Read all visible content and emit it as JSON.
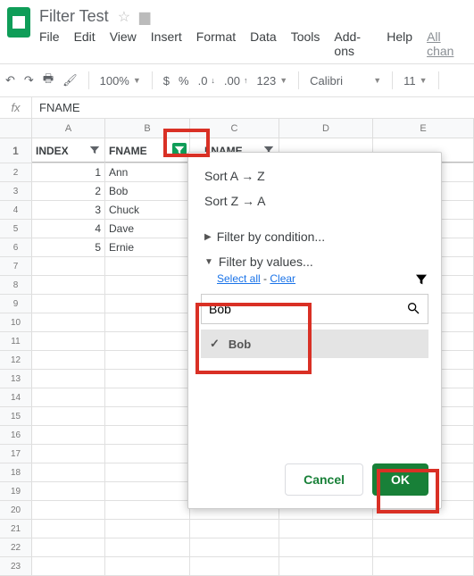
{
  "doc": {
    "title": "Filter Test"
  },
  "menu": {
    "file": "File",
    "edit": "Edit",
    "view": "View",
    "insert": "Insert",
    "format": "Format",
    "data": "Data",
    "tools": "Tools",
    "addons": "Add-ons",
    "help": "Help",
    "allchanges": "All chan"
  },
  "toolbar": {
    "zoom": "100%",
    "dollar": "$",
    "percent": "%",
    "dec_less": ".0",
    "dec_more": ".00",
    "numfmt": "123",
    "font": "Calibri",
    "size": "11"
  },
  "formula": {
    "value": "FNAME"
  },
  "columns": {
    "a": "A",
    "b": "B",
    "c": "C",
    "d": "D",
    "e": "E"
  },
  "headers": {
    "a": "INDEX",
    "b": "FNAME",
    "c": "LNAME"
  },
  "data_rows": {
    "r1": {
      "a": "1",
      "b": "Ann"
    },
    "r2": {
      "a": "2",
      "b": "Bob"
    },
    "r3": {
      "a": "3",
      "b": "Chuck"
    },
    "r4": {
      "a": "4",
      "b": "Dave"
    },
    "r5": {
      "a": "5",
      "b": "Ernie"
    }
  },
  "row_nums": {
    "r0": "1",
    "r1": "2",
    "r2": "3",
    "r3": "4",
    "r4": "5",
    "r5": "6",
    "r6": "7",
    "r7": "8",
    "r8": "9",
    "r9": "10",
    "r10": "11",
    "r11": "12",
    "r12": "13",
    "r13": "14",
    "r14": "15",
    "r15": "16",
    "r16": "17",
    "r17": "18",
    "r18": "19",
    "r19": "20",
    "r20": "21",
    "r21": "22",
    "r22": "23"
  },
  "popup": {
    "sort_az": "Sort A → Z",
    "sort_za": "Sort Z → A",
    "filter_cond": "Filter by condition...",
    "filter_val": "Filter by values...",
    "select_all": "Select all",
    "dash": " - ",
    "clear": "Clear",
    "search_value": "Bob",
    "result": "Bob",
    "cancel": "Cancel",
    "ok": "OK"
  }
}
